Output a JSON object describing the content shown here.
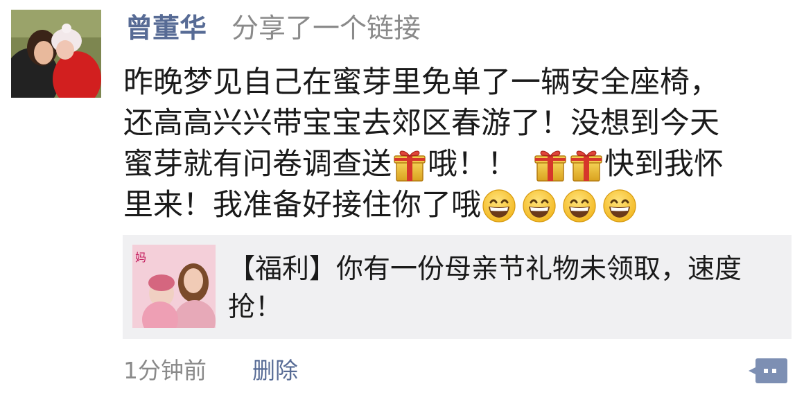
{
  "post": {
    "author": "曾董华",
    "action": "分享了一个链接",
    "text": {
      "line1": "昨晚梦见自己在蜜芽里免单了一辆安全座椅，",
      "line2": "还高高兴兴带宝宝去郊区春游了！没想到今天",
      "line3a": "蜜芽就有问卷调查送",
      "line3b": "哦！！",
      "line3c": "快到我怀",
      "line4a": "里来！我准备好接住你了哦"
    },
    "emoji": [
      "gift-emoji",
      "grinning-face-emoji"
    ]
  },
  "link": {
    "thumb_caption": "妈",
    "title": "【福利】你有一份母亲节礼物未领取，速度抢！"
  },
  "footer": {
    "time": "1分钟前",
    "delete_label": "删除"
  },
  "colors": {
    "name_link": "#576b95",
    "meta_gray": "#8a8a8a",
    "card_bg": "#f0f0f2"
  }
}
